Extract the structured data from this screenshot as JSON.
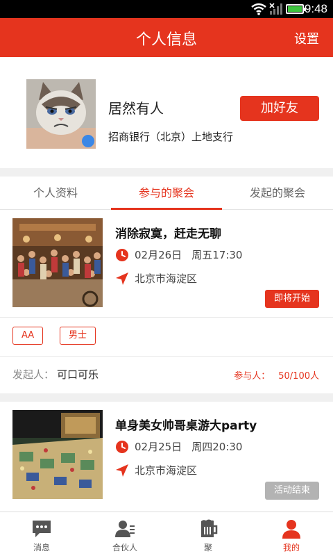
{
  "status_bar": {
    "time": "9:48"
  },
  "header": {
    "title": "个人信息",
    "settings_label": "设置"
  },
  "profile": {
    "name": "居然有人",
    "organization": "招商银行（北京）上地支行",
    "add_friend_label": "加好友"
  },
  "tabs": [
    {
      "label": "个人资料",
      "active": false
    },
    {
      "label": "参与的聚会",
      "active": true
    },
    {
      "label": "发起的聚会",
      "active": false
    }
  ],
  "events": [
    {
      "title": "消除寂寞，赶走无聊",
      "date": "02月26日",
      "weekday_time": "周五17:30",
      "location": "北京市海淀区",
      "status": "即将开始",
      "tags": [
        "AA",
        "男士"
      ],
      "initiator_label": "发起人：",
      "initiator": "可口可乐",
      "participants_label": "参与人：",
      "participants": "50/100人"
    },
    {
      "title": "单身美女帅哥桌游大party",
      "date": "02月25日",
      "weekday_time": "周四20:30",
      "location": "北京市海淀区",
      "status": "活动结束"
    }
  ],
  "nav": [
    {
      "label": "消息",
      "icon": "chat-icon",
      "active": false
    },
    {
      "label": "合伙人",
      "icon": "partner-icon",
      "active": false
    },
    {
      "label": "聚",
      "icon": "beer-icon",
      "active": false
    },
    {
      "label": "我的",
      "icon": "user-icon",
      "active": true
    }
  ],
  "colors": {
    "accent": "#e5341e",
    "ended": "#b3b3b3",
    "online_dot": "#3b87e6"
  }
}
